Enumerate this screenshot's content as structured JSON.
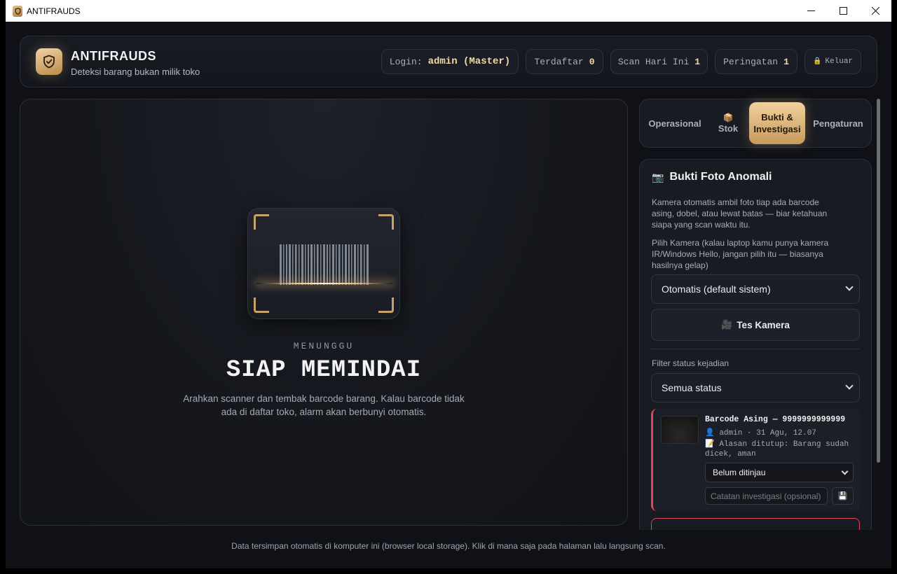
{
  "window": {
    "title": "ANTIFRAUDS",
    "min": "—",
    "max": "☐",
    "close": "✕"
  },
  "header": {
    "title": "ANTIFRAUDS",
    "subtitle": "Deteksi barang bukan milik toko",
    "login_label": "Login:",
    "login_value": "admin (Master)",
    "registered_label": "Terdaftar",
    "registered_value": "0",
    "scan_today_label": "Scan Hari Ini",
    "scan_today_value": "1",
    "warnings_label": "Peringatan",
    "warnings_value": "1",
    "logout_label": "Keluar"
  },
  "scanner": {
    "state_label": "MENUNGGU",
    "state_title": "SIAP MEMINDAI",
    "description": "Arahkan scanner dan tembak barcode barang. Kalau barcode tidak ada di daftar toko, alarm akan berbunyi otomatis."
  },
  "tabs": [
    {
      "label": "Operasional",
      "active": false
    },
    {
      "label": "Stok",
      "active": false
    },
    {
      "label": "Bukti & Investigasi",
      "active": true
    },
    {
      "label": "Pengaturan",
      "active": false
    }
  ],
  "evidence": {
    "title": "Bukti Foto Anomali",
    "intro": "Kamera otomatis ambil foto tiap ada barcode asing, dobel, atau lewat batas — biar ketahuan siapa yang scan waktu itu.",
    "camera_hint": "Pilih Kamera (kalau laptop kamu punya kamera IR/Windows Hello, jangan pilih itu — biasanya hasilnya gelap)",
    "camera_selected": "Otomatis (default sistem)",
    "test_camera_label": "Tes Kamera",
    "filter_label": "Filter status kejadian",
    "filter_selected": "Semua status",
    "incidents": [
      {
        "title": "Barcode Asing — 9999999999999",
        "meta": "admin · 31 Agu, 12.07",
        "note": "Alasan ditutup: Barang sudah dicek, aman",
        "status_selected": "Belum ditinjau",
        "note_placeholder": "Catatan investigasi (opsional)"
      }
    ]
  },
  "footer": "Data tersimpan otomatis di komputer ini (browser local storage). Klik di mana saja pada halaman lalu langsung scan.",
  "colors": {
    "accent": "#d4aa6e",
    "danger": "#e0465a",
    "background": "#0f1116"
  }
}
